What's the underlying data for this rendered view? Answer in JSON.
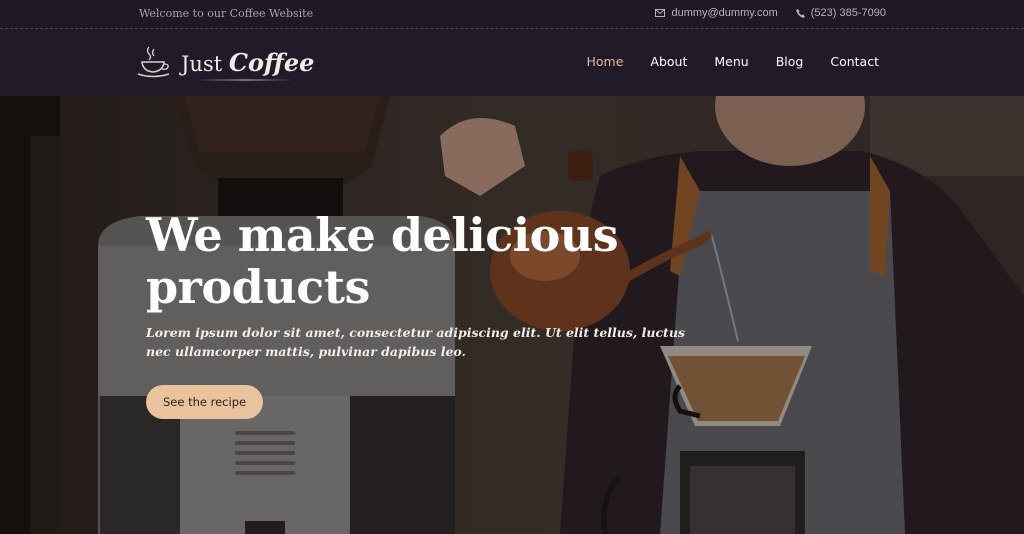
{
  "topbar": {
    "welcome": "Welcome to our Coffee Website",
    "email": "dummy@dummy.com",
    "phone": "(523) 385-7090",
    "email_icon": "mail-icon",
    "phone_icon": "phone-icon"
  },
  "header": {
    "logo_icon": "coffee-cup-icon",
    "brand_plain": "Just",
    "brand_italic": "Coffee",
    "nav": [
      {
        "label": "Home",
        "active": true
      },
      {
        "label": "About",
        "active": false
      },
      {
        "label": "Menu",
        "active": false
      },
      {
        "label": "Blog",
        "active": false
      },
      {
        "label": "Contact",
        "active": false
      }
    ]
  },
  "hero": {
    "title_line1": "We make delicious",
    "title_line2": "products",
    "subtitle": "Lorem ipsum dolor sit amet, consectetur adipiscing elit. Ut elit tellus, luctus nec ullamcorper mattis, pulvinar dapibus leo.",
    "button_label": "See the recipe"
  },
  "colors": {
    "accent": "#e3b893",
    "button_bg": "#e8c39d",
    "header_bg": "#201a29"
  }
}
